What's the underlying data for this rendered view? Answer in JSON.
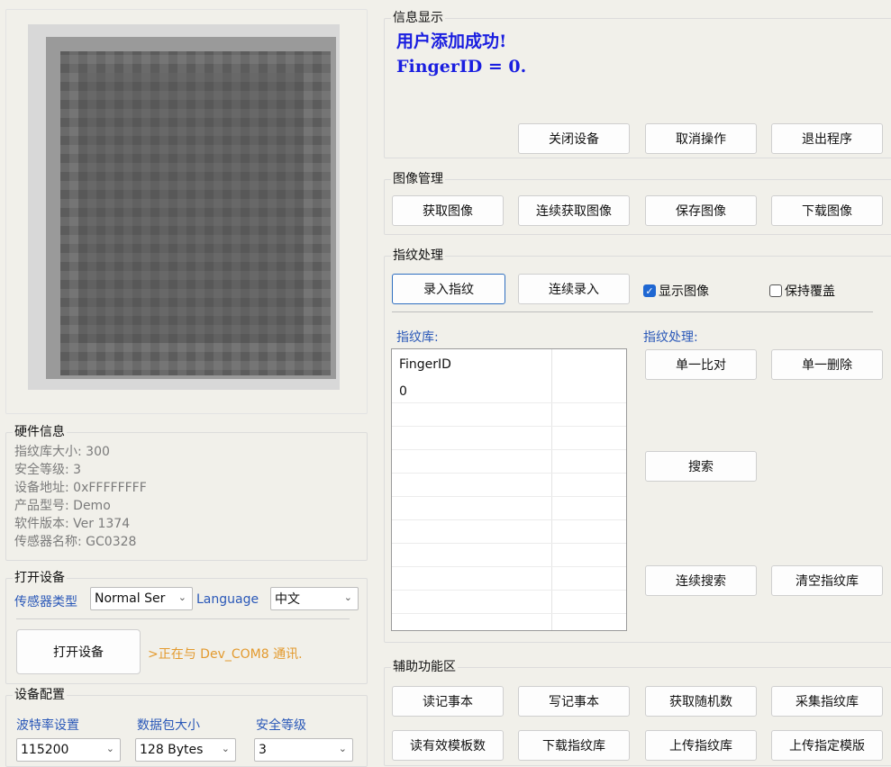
{
  "info": {
    "title": "信息显示",
    "message_line1": "用户添加成功!",
    "message_line2": "FingerID = 0.",
    "buttons": {
      "close_device": "关闭设备",
      "cancel_op": "取消操作",
      "exit_program": "退出程序"
    }
  },
  "image_mgmt": {
    "title": "图像管理",
    "buttons": {
      "get_image": "获取图像",
      "continuous_get": "连续获取图像",
      "save_image": "保存图像",
      "download_image": "下载图像"
    }
  },
  "fp_process": {
    "title": "指纹处理",
    "enroll": "录入指纹",
    "continuous_enroll": "连续录入",
    "show_image": {
      "label": "显示图像",
      "checked": true
    },
    "keep_cover": {
      "label": "保持覆盖",
      "checked": false
    },
    "library_label": "指纹库:",
    "process_label": "指纹处理:",
    "table": {
      "header": "FingerID",
      "rows": [
        "0"
      ]
    },
    "buttons": {
      "single_match": "单一比对",
      "single_delete": "单一删除",
      "search": "搜索",
      "continuous_search": "连续搜索",
      "clear_library": "清空指纹库"
    }
  },
  "hardware": {
    "title": "硬件信息",
    "lines": [
      "指纹库大小: 300",
      "安全等级: 3",
      "设备地址: 0xFFFFFFFF",
      "产品型号:  Demo",
      "软件版本: Ver 1374",
      "传感器名称: GC0328"
    ]
  },
  "open_device": {
    "title": "打开设备",
    "sensor_type_label": "传感器类型",
    "sensor_type_value": "Normal Ser",
    "language_label": "Language",
    "language_value": "中文",
    "open_button": "打开设备",
    "status": ">正在与 Dev_COM8 通讯."
  },
  "device_config": {
    "title": "设备配置",
    "baud_label": "波特率设置",
    "packet_label": "数据包大小",
    "security_label": "安全等级",
    "baud_value": "115200",
    "packet_value": "128 Bytes",
    "security_value": "3"
  },
  "aux": {
    "title": "辅助功能区",
    "buttons": {
      "read_notepad": "读记事本",
      "write_notepad": "写记事本",
      "get_random": "获取随机数",
      "collect_library": "采集指纹库",
      "read_valid_count": "读有效模板数",
      "download_library": "下载指纹库",
      "upload_library": "上传指纹库",
      "upload_template": "上传指定模版"
    }
  },
  "colors": {
    "accent_blue": "#2a58b8",
    "message_blue": "#1a1ee0",
    "status_orange": "#e39a2e",
    "checkbox_blue": "#1f67d2"
  }
}
